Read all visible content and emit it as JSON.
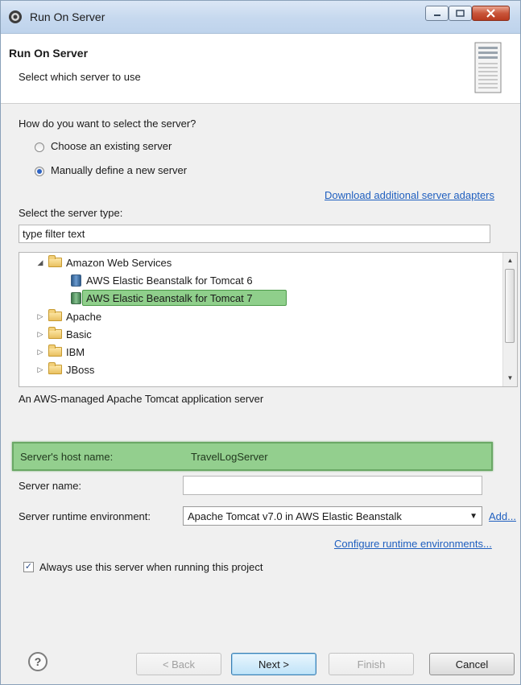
{
  "window": {
    "title": "Run On Server"
  },
  "header": {
    "title": "Run On Server",
    "subtitle": "Select which server to use"
  },
  "selection": {
    "question": "How do you want to select the server?",
    "options": [
      {
        "label": "Choose an existing server",
        "selected": false
      },
      {
        "label": "Manually define a new server",
        "selected": true
      }
    ],
    "download_link": "Download additional server adapters"
  },
  "server_type": {
    "label": "Select the server type:",
    "filter_value": "type filter text",
    "tree": [
      {
        "label": "Amazon Web Services",
        "kind": "folder",
        "expanded": true
      },
      {
        "label": "AWS Elastic Beanstalk for Tomcat 6",
        "kind": "server"
      },
      {
        "label": "AWS Elastic Beanstalk for Tomcat 7",
        "kind": "server",
        "selected": true
      },
      {
        "label": "Apache",
        "kind": "folder"
      },
      {
        "label": "Basic",
        "kind": "folder"
      },
      {
        "label": "IBM",
        "kind": "folder"
      },
      {
        "label": "JBoss",
        "kind": "folder"
      }
    ],
    "description": "An AWS-managed Apache Tomcat application server"
  },
  "form": {
    "host_label": "Server's host name:",
    "host_value": "TravelLogServer",
    "name_label": "Server name:",
    "name_value": "",
    "runtime_label": "Server runtime environment:",
    "runtime_value": "Apache Tomcat v7.0 in AWS Elastic Beanstalk",
    "add_link": "Add...",
    "configure_link": "Configure runtime environments...",
    "always_use_label": "Always use this server when running this project",
    "always_use_checked": true
  },
  "buttons": {
    "help": "?",
    "back": "< Back",
    "next": "Next >",
    "finish": "Finish",
    "cancel": "Cancel"
  },
  "colors": {
    "highlight_green": "#93cf8e",
    "link_blue": "#1f5fbf"
  }
}
